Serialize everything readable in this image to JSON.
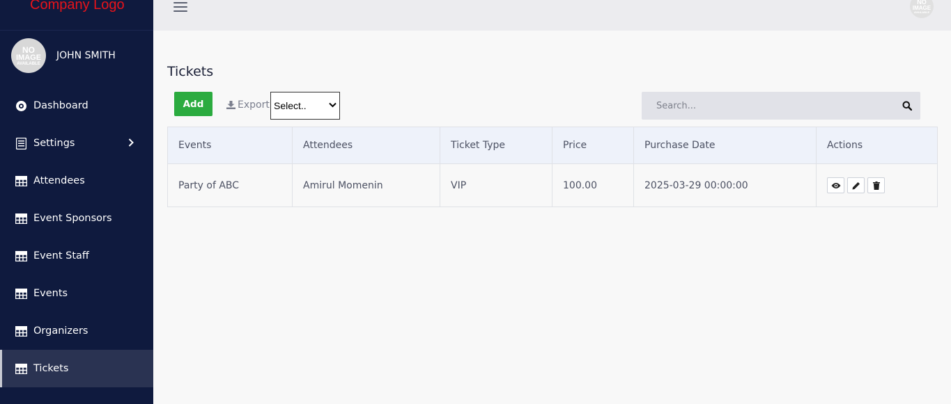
{
  "brand": {
    "logo_text": "Company Logo"
  },
  "user": {
    "name": "JOHN SMITH",
    "avatar_lines": [
      "NO",
      "IMAGE",
      "AVAILABLE"
    ]
  },
  "sidebar": {
    "items": [
      {
        "label": "Dashboard",
        "icon": "dashboard-icon"
      },
      {
        "label": "Settings",
        "icon": "settings-list-icon"
      },
      {
        "label": "Attendees",
        "icon": "grid-icon"
      },
      {
        "label": "Event Sponsors",
        "icon": "grid-icon"
      },
      {
        "label": "Event Staff",
        "icon": "grid-icon"
      },
      {
        "label": "Events",
        "icon": "grid-icon"
      },
      {
        "label": "Organizers",
        "icon": "grid-icon"
      },
      {
        "label": "Tickets",
        "icon": "grid-icon"
      }
    ],
    "active": "Tickets"
  },
  "page": {
    "title": "Tickets",
    "add_label": "Add",
    "export_label": "Export",
    "select_value": "Select..",
    "search_placeholder": "Search..."
  },
  "table": {
    "columns": [
      "Events",
      "Attendees",
      "Ticket Type",
      "Price",
      "Purchase Date",
      "Actions"
    ],
    "rows": [
      {
        "event": "Party of ABC",
        "attendee": "Amirul Momenin",
        "ticket_type": "VIP",
        "price": "100.00",
        "purchase_date": "2025-03-29 00:00:00"
      }
    ]
  },
  "colors": {
    "sidebar_bg": "#0f1a3e",
    "brand_red": "#e8131a",
    "add_green": "#2bab3f"
  }
}
